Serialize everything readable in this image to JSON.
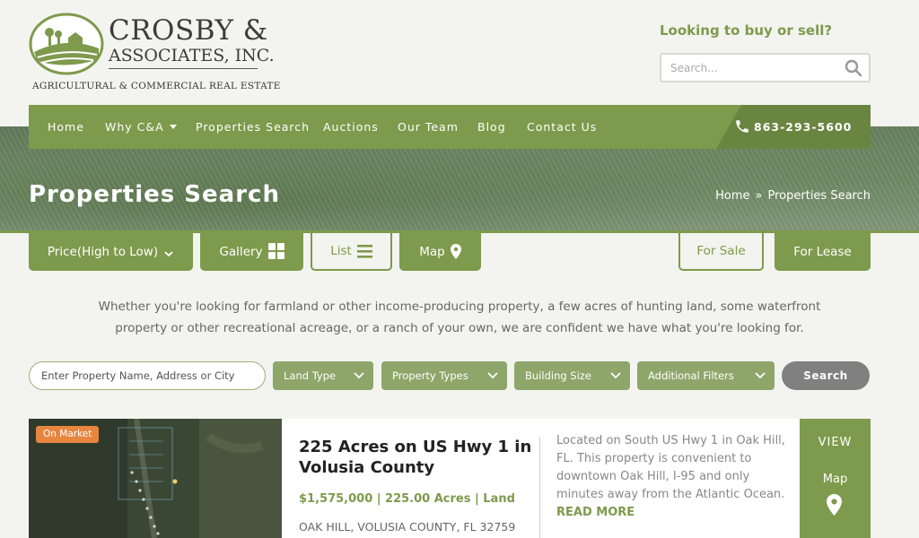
{
  "header": {
    "brand_line1": "CROSBY &",
    "brand_line2": "ASSOCIATES, INC.",
    "brand_tagline": "AGRICULTURAL & COMMERCIAL REAL ESTATE",
    "buy_sell_text": "Looking to buy or sell?",
    "search_placeholder": "Search..."
  },
  "nav": {
    "items": [
      "Home",
      "Why C&A",
      "Properties Search",
      "Auctions",
      "Our Team",
      "Blog",
      "Contact Us"
    ],
    "phone": "863-293-5600"
  },
  "banner": {
    "title": "Properties Search",
    "breadcrumb_home": "Home",
    "breadcrumb_sep": "»",
    "breadcrumb_current": "Properties Search"
  },
  "toolbar": {
    "sort_label": "Price(High to Low)",
    "gallery_label": "Gallery",
    "list_label": "List",
    "map_label": "Map",
    "for_sale_label": "For Sale",
    "for_lease_label": "For Lease"
  },
  "intro_text": "Whether you're looking for farmland or other income-producing property, a few acres of hunting land, some waterfront property or other recreational acreage, or a ranch of your own, we are confident we have what you're looking for.",
  "filters": {
    "property_placeholder": "Enter Property Name, Address or City",
    "land_type": "Land Type",
    "property_types": "Property Types",
    "building_size": "Building Size",
    "additional_filters": "Additional Filters",
    "search_label": "Search"
  },
  "listing": {
    "badge": "On Market",
    "title": "225 Acres on US Hwy 1 in Volusia County",
    "price_line": "$1,575,000 | 225.00 Acres | Land",
    "address": "OAK HILL, VOLUSIA COUNTY, FL 32759",
    "description": "Located on South US Hwy 1 in Oak Hill, FL. This property is convenient to downtown Oak Hill, I-95 and only minutes away from the Atlantic Ocean.",
    "read_more": "READ MORE",
    "view_label": "VIEW",
    "map_label": "Map"
  },
  "colors": {
    "brand_green": "#7e9a4c",
    "badge_orange": "#e8853f",
    "search_gray": "#808080"
  }
}
